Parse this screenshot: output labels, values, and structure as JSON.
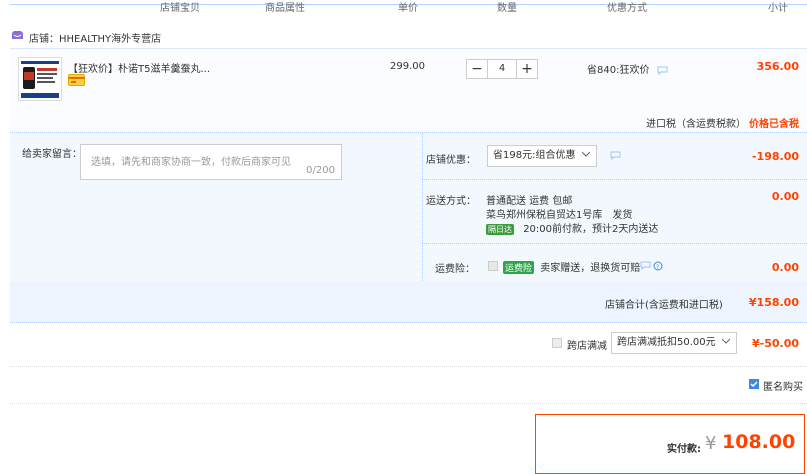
{
  "header": {
    "columns": [
      "店铺宝贝",
      "商品属性",
      "单价",
      "数量",
      "优惠方式",
      "小计"
    ]
  },
  "shop": {
    "name": "店铺：HHEALTHY海外专营店"
  },
  "item": {
    "title": "【狂欢价】朴诺T5滋羊羹蚕丸...",
    "unit_price": "299.00",
    "quantity": "4",
    "discount": "省840:狂欢价",
    "subtotal": "356.00",
    "tax_label": "进口税（含运费税款）",
    "tax_value": "价格已含税"
  },
  "message": {
    "label": "给卖家留言：",
    "placeholder": "选填，请先和商家协商一致，付款后商家可见",
    "count": "0/200"
  },
  "shop_coupon": {
    "label": "店铺优惠：",
    "selected": "省198元:组合优惠",
    "amount": "-198.00"
  },
  "shipping": {
    "label": "运送方式：",
    "line1": "普通配送 运费 包邮",
    "line2": "菜鸟郑州保税自贸达1号库　发货",
    "tag": "隔日达",
    "line3": "20:00前付款，预计2天内送达",
    "amount": "0.00"
  },
  "insurance": {
    "label": "运费险：",
    "tag": "运费险",
    "text": "卖家赠送，退换货可赔",
    "amount": "0.00"
  },
  "shop_total": {
    "label": "店铺合计(含运费和进口税)",
    "amount": "¥158.00"
  },
  "cross_store": {
    "label": "跨店满减",
    "selected": "跨店满减抵扣50.00元",
    "amount": "¥-50.00"
  },
  "anonymous": {
    "label": "匿名购买",
    "checked": true
  },
  "payment": {
    "label": "实付款:",
    "currency": "¥",
    "amount": "108.00"
  },
  "colors": {
    "accent": "#ff4400",
    "link_blue": "#b2d1ff",
    "panel_bg": "#f3f8fe"
  }
}
